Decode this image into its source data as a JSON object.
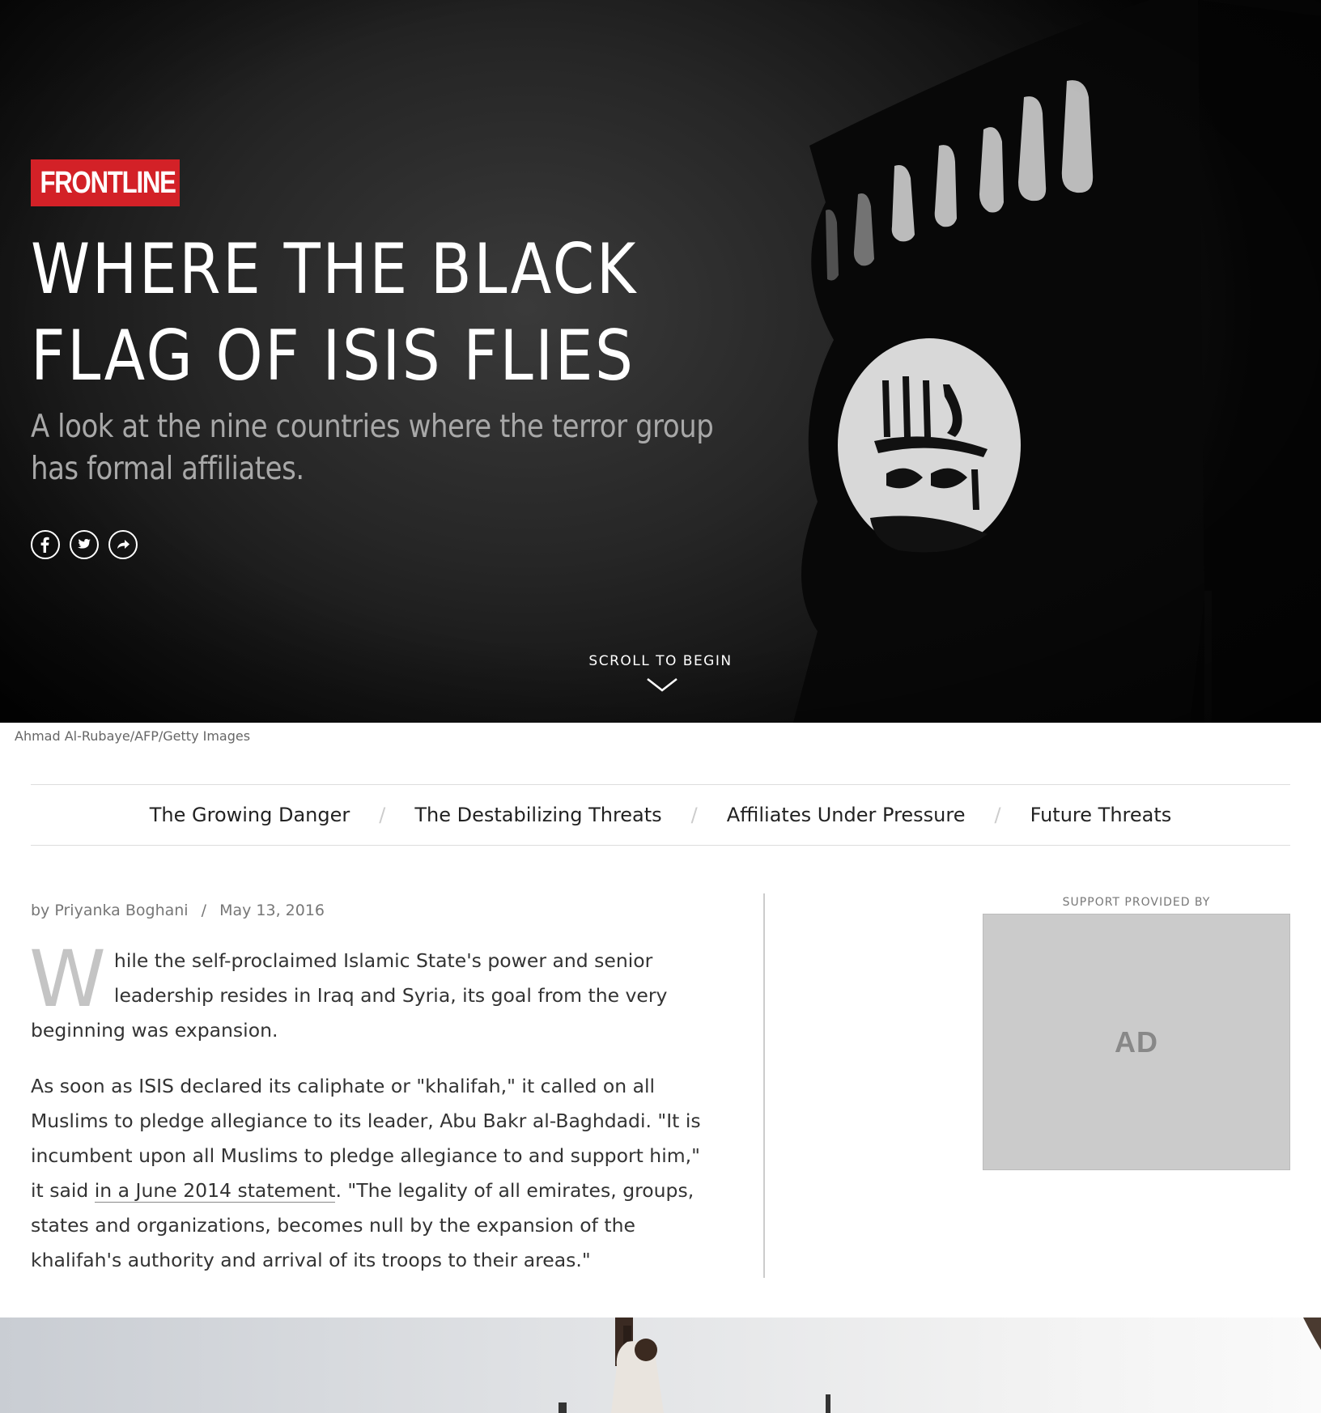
{
  "hero": {
    "brand": "FRONTLINE",
    "title_line1": "WHERE THE BLACK",
    "title_line2": "FLAG OF ISIS FLIES",
    "subtitle": "A look at the nine countries where the terror group has formal affiliates.",
    "share_icons": [
      "facebook-icon",
      "twitter-icon",
      "share-icon"
    ],
    "scroll_label": "SCROLL TO BEGIN",
    "photo_credit": "Ahmad Al-Rubaye/AFP/Getty Images",
    "accent_color": "#d32127"
  },
  "nav": {
    "items": [
      "The Growing Danger",
      "The Destabilizing Threats",
      "Affiliates Under Pressure",
      "Future Threats"
    ],
    "separator": "/"
  },
  "article": {
    "author_prefix": "by",
    "author": "Priyanka Boghani",
    "byline_sep": "/",
    "date": "May 13, 2016",
    "dropcap": "W",
    "p1_rest": "hile the self-proclaimed Islamic State's power and senior leadership resides in Iraq and Syria, its goal from the very beginning was expansion.",
    "p2_before": "As soon as ISIS declared its caliphate or \"khalifah,\" it called on all Muslims to pledge allegiance to its leader, Abu Bakr al-Baghdadi. \"It is incumbent upon all Muslims to pledge allegiance to and support him,\" it said ",
    "p2_link": "in a June 2014 statement",
    "p2_after": ". \"The legality of all emirates, groups, states and organizations, becomes null by the expansion of the khalifah's authority and arrival of its troops to their areas.\""
  },
  "sidebar": {
    "ad_label": "SUPPORT PROVIDED BY",
    "ad_text": "AD"
  }
}
